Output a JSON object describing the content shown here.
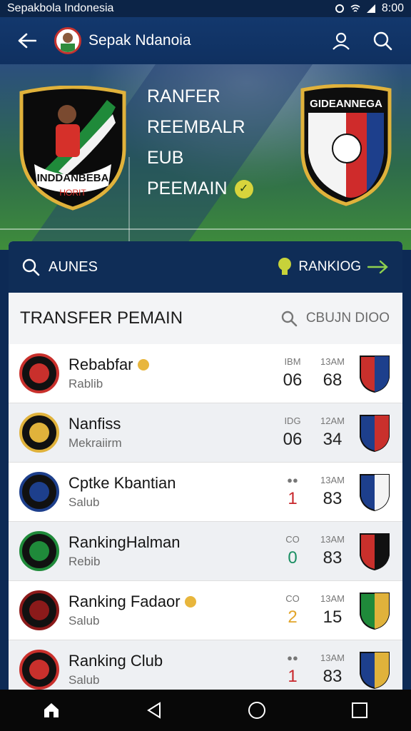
{
  "statusbar": {
    "left_text": "Sepakbola Indonesia",
    "time": "8:00"
  },
  "appbar": {
    "title": "Sepak Ndanoia"
  },
  "hero": {
    "lines": [
      "RANFER",
      "REEMBALR",
      "EUB",
      "PEEMAIN"
    ],
    "left_crest": "INDDANBEBA",
    "left_crest_sub": "HORIT",
    "right_crest": "GIDEANNEGA"
  },
  "panel": {
    "tab_left": "AUNES",
    "tab_right": "RANKIOG",
    "section_title": "TRANSFER PEMAIN",
    "section_search": "CBUJN DIOO",
    "rows": [
      {
        "name": "Rebabfar",
        "sub": "Rablib",
        "c1_top": "IBM",
        "c1": "06",
        "c2_top": "13AM",
        "c2": "68",
        "c1_color": "#222222",
        "badge": true
      },
      {
        "name": "Nanfiss",
        "sub": "Mekraiirm",
        "c1_top": "IDG",
        "c1": "06",
        "c2_top": "12AM",
        "c2": "34",
        "c1_color": "#222222",
        "badge": false
      },
      {
        "name": "Cptke Kbantian",
        "sub": "Salub",
        "c1_top": "●●",
        "c1": "1",
        "c2_top": "13AM",
        "c2": "83",
        "c1_color": "#c8262b",
        "badge": false
      },
      {
        "name": "RankingHalman",
        "sub": "Rebib",
        "c1_top": "CO",
        "c1": "0",
        "c2_top": "13AM",
        "c2": "83",
        "c1_color": "#1b8f63",
        "badge": false
      },
      {
        "name": "Ranking Fadaor",
        "sub": "Salub",
        "c1_top": "CO",
        "c1": "2",
        "c2_top": "13AM",
        "c2": "15",
        "c1_color": "#e2a52a",
        "badge": true
      },
      {
        "name": "Ranking Club",
        "sub": "Salub",
        "c1_top": "●●",
        "c1": "1",
        "c2_top": "13AM",
        "c2": "83",
        "c1_color": "#c8262b",
        "badge": false
      }
    ]
  },
  "icons": [
    "back-arrow-icon",
    "user-icon",
    "search-icon",
    "lightbulb-icon",
    "arrow-right-icon",
    "home-icon",
    "back-triangle-icon",
    "circle-home-icon",
    "square-recents-icon"
  ],
  "colors": {
    "appbar": "#13386d",
    "panel_head": "#0f2d57",
    "accent_yellow": "#d8d43c"
  }
}
